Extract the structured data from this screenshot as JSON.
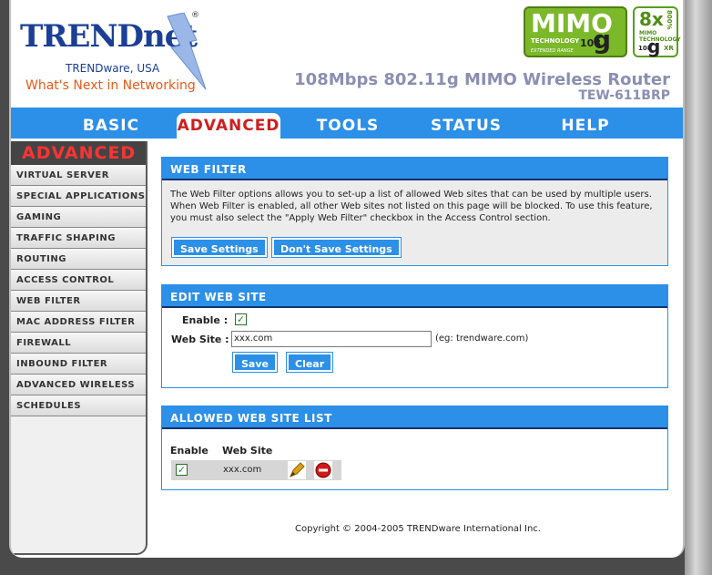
{
  "brand": {
    "logo": "TRENDnet",
    "registered": "®",
    "company": "TRENDware, USA",
    "tagline": "What's Next in Networking"
  },
  "badges": {
    "mimo_word": "MIMO",
    "mimo_line1": "TECHNOLOGY",
    "mimo_line2": "EXTENDED RANGE",
    "mimo_speed": "108",
    "mimo_g": "g",
    "eight_x": "8x",
    "eight_pct": "800%",
    "eight_mimo": "MIMO TECHNOLOGY",
    "eight_108": "108",
    "eight_g": "g",
    "eight_xr": "XR"
  },
  "product": {
    "title": "108Mbps 802.11g MIMO Wireless Router",
    "model": "TEW-611BRP"
  },
  "nav": {
    "items": [
      "BASIC",
      "ADVANCED",
      "TOOLS",
      "STATUS",
      "HELP"
    ],
    "active": "ADVANCED"
  },
  "sidebar": {
    "heading": "ADVANCED",
    "items": [
      "VIRTUAL SERVER",
      "SPECIAL APPLICATIONS",
      "GAMING",
      "TRAFFIC SHAPING",
      "ROUTING",
      "ACCESS CONTROL",
      "WEB FILTER",
      "MAC ADDRESS FILTER",
      "FIREWALL",
      "INBOUND FILTER",
      "ADVANCED WIRELESS",
      "SCHEDULES"
    ]
  },
  "web_filter": {
    "heading": "WEB FILTER",
    "description": "The Web Filter options allows you to set-up a list of allowed Web sites that can be used by multiple users. When Web Filter is enabled, all other Web sites not listed on this page will be blocked. To use this feature, you must also select the \"Apply Web Filter\" checkbox in the Access Control section.",
    "save_label": "Save Settings",
    "dont_save_label": "Don't Save Settings"
  },
  "edit_site": {
    "heading": "EDIT WEB SITE",
    "enable_label": "Enable :",
    "enable_checked": true,
    "site_label": "Web Site :",
    "site_value": "xxx.com",
    "site_hint": "(eg: trendware.com)",
    "save_label": "Save",
    "clear_label": "Clear"
  },
  "site_list": {
    "heading": "ALLOWED WEB SITE LIST",
    "col_enable": "Enable",
    "col_site": "Web Site",
    "rows": [
      {
        "enabled": true,
        "site": "xxx.com"
      }
    ]
  },
  "footer": {
    "copyright": "Copyright © 2004-2005 TRENDware International Inc."
  },
  "colors": {
    "accent_blue": "#2c8fe8",
    "active_red": "#cc1f1f",
    "brand_blue": "#1b3f95",
    "tagline_orange": "#e55a1a",
    "badge_green": "#7bb82a"
  }
}
